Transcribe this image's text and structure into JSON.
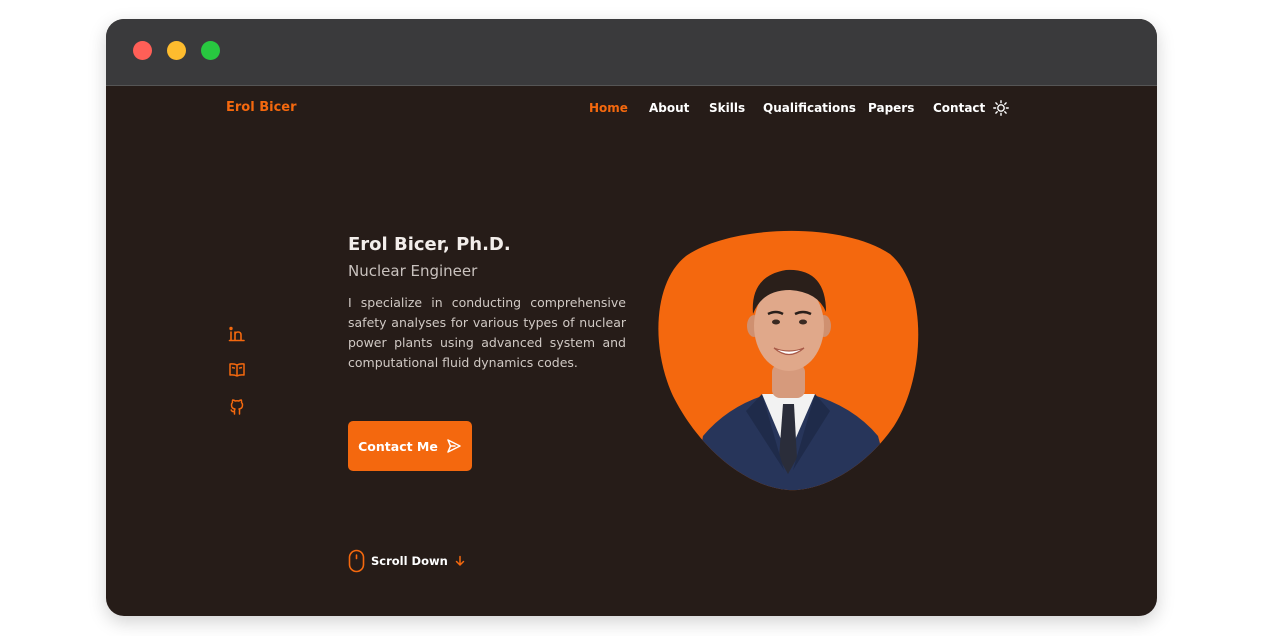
{
  "window": {
    "controls": [
      "close",
      "minimize",
      "maximize"
    ]
  },
  "header": {
    "logo": "Erol Bicer",
    "nav": [
      {
        "label": "Home",
        "active": true
      },
      {
        "label": "About",
        "active": false
      },
      {
        "label": "Skills",
        "active": false
      },
      {
        "label": "Qualifications",
        "active": false
      },
      {
        "label": "Papers",
        "active": false
      },
      {
        "label": "Contact",
        "active": false
      }
    ],
    "theme_icon": "sun-icon"
  },
  "social": [
    "linkedin-icon",
    "book-icon",
    "github-icon"
  ],
  "hero": {
    "name": "Erol Bicer, Ph.D.",
    "title": "Nuclear Engineer",
    "description": "I specialize in conducting comprehensive safety analyses for various types of nuclear power plants using advanced system and computational fluid dynamics codes.",
    "cta_label": "Contact Me",
    "scroll_label": "Scroll Down"
  },
  "colors": {
    "accent": "#f4680e",
    "background": "#261c18",
    "titlebar": "#3a3a3c"
  }
}
